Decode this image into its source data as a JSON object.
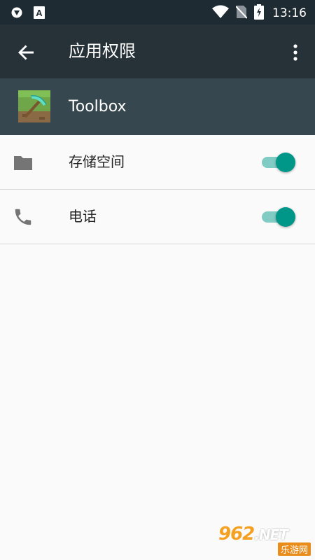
{
  "status_bar": {
    "time": "13:16",
    "left_icons": [
      "vpn-shield-icon",
      "font-a-icon"
    ],
    "right_icons": [
      "wifi-icon",
      "no-sim-icon",
      "battery-charging-icon"
    ]
  },
  "toolbar": {
    "title": "应用权限",
    "back_icon": "arrow-back-icon",
    "more_icon": "more-vert-icon"
  },
  "app": {
    "name": "Toolbox",
    "icon": "pickaxe-icon"
  },
  "permissions": [
    {
      "label": "存储空间",
      "icon": "folder-icon",
      "enabled": true
    },
    {
      "label": "电话",
      "icon": "phone-icon",
      "enabled": true
    }
  ],
  "watermark": {
    "main": "962",
    "suffix": ".NET",
    "sub": "乐游网"
  },
  "colors": {
    "status_bar": "#1f2b32",
    "toolbar": "#263238",
    "app_header": "#37474f",
    "switch_thumb": "#009688",
    "switch_track": "#80cbc4",
    "background": "#fafafa"
  }
}
